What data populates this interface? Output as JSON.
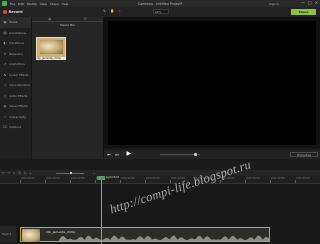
{
  "window": {
    "title": "Camtasia - Untitled Project*",
    "signin": "Sign In",
    "controls": [
      "—",
      "□",
      "✕"
    ]
  },
  "menu": [
    "File",
    "Edit",
    "Modify",
    "View",
    "Share",
    "Help"
  ],
  "toolbar": {
    "record_label": "Record",
    "zoom": "62%",
    "export_label": "Share"
  },
  "sidebar": {
    "items": [
      {
        "icon": "film-icon",
        "glyph": "▣",
        "label": "Media"
      },
      {
        "icon": "library-icon",
        "glyph": "▤",
        "label": "Annotations"
      },
      {
        "icon": "transition-icon",
        "glyph": "◧",
        "label": "Transitions"
      },
      {
        "icon": "behavior-icon",
        "glyph": "✦",
        "label": "Behaviors"
      },
      {
        "icon": "animation-icon",
        "glyph": "➚",
        "label": "Animations"
      },
      {
        "icon": "cursor-icon",
        "glyph": "⬉",
        "label": "Cursor Effects"
      },
      {
        "icon": "voice-icon",
        "glyph": "♪",
        "label": "Voice Narration"
      },
      {
        "icon": "audio-icon",
        "glyph": "♫",
        "label": "Audio Effects"
      },
      {
        "icon": "visual-icon",
        "glyph": "◍",
        "label": "Visual Effects"
      },
      {
        "icon": "interactivity-icon",
        "glyph": "☝",
        "label": "Interactivity"
      },
      {
        "icon": "captions-icon",
        "glyph": "CC",
        "label": "Captions"
      }
    ],
    "add": "+"
  },
  "media_bin": {
    "tabs": [
      "▤",
      "☰"
    ],
    "heading": "Media Bin",
    "clip_name": "clip_jamenta_chrtip"
  },
  "player": {
    "controls": [
      "⏮",
      "⏭"
    ],
    "play": "▶",
    "properties_label": "Properties"
  },
  "timeline": {
    "tools": [
      "↶",
      "↷",
      "✂",
      "⎘",
      "⎗",
      "+",
      "−"
    ],
    "ruler": [
      "0:00:00;00",
      "0:00:10;00",
      "0:00:20;00",
      "0:00:30;00",
      "0:00:40;00",
      "0:00:50;00",
      "0:01:00;00",
      "0:01:10;00",
      "0:01:20;00",
      "0:01:30;00",
      "0:01:40;00",
      "0:01:50;00"
    ],
    "playhead_time": "0:00:26;18",
    "track_label": "Track 1",
    "clip_label": "clip_jamenta_chrtip"
  },
  "watermark": "http://compi-life.blogspot.ru",
  "colors": {
    "accent": "#8fc33c",
    "record": "#e2452f",
    "playhead": "#45a45a",
    "clip_border": "#b8a74a"
  }
}
